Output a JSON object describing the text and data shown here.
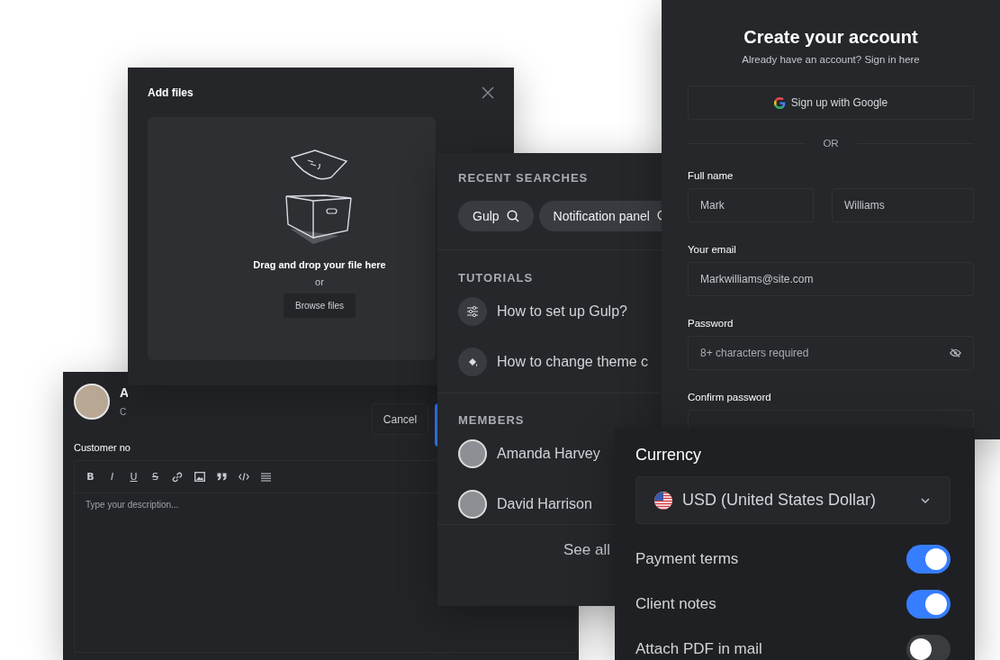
{
  "add_files_dialog": {
    "title": "Add files",
    "dropzone_text": "Drag and drop your file here",
    "or_text": "or",
    "browse_button": "Browse files"
  },
  "customer_card": {
    "name": "A",
    "subtitle": "C",
    "cancel_button": "Cancel",
    "note_label": "Customer no",
    "toolbar_letters": [
      "B",
      "I",
      "U",
      "S"
    ],
    "editor_placeholder": "Type your description..."
  },
  "search_panel": {
    "recent_heading": "RECENT SEARCHES",
    "recent_chips": [
      "Gulp",
      "Notification panel"
    ],
    "tutorials_heading": "TUTORIALS",
    "tutorials": [
      "How to set up Gulp?",
      "How to change theme c"
    ],
    "members_heading": "MEMBERS",
    "members": [
      "Amanda Harvey",
      "David Harrison"
    ],
    "see_all": "See all"
  },
  "signup_card": {
    "title": "Create your account",
    "subtitle": "Already have an account? Sign in here",
    "google_button": "Sign up with Google",
    "divider": "OR",
    "full_name_label": "Full name",
    "first_name": "Mark",
    "last_name": "Williams",
    "email_label": "Your email",
    "email": "Markwilliams@site.com",
    "password_label": "Password",
    "password_placeholder": "8+ characters required",
    "confirm_label": "Confirm password"
  },
  "currency_card": {
    "label": "Currency",
    "currency": "USD (United States Dollar)",
    "toggles": [
      {
        "label": "Payment terms",
        "on": true
      },
      {
        "label": "Client notes",
        "on": true
      },
      {
        "label": "Attach PDF in mail",
        "on": false
      }
    ]
  }
}
